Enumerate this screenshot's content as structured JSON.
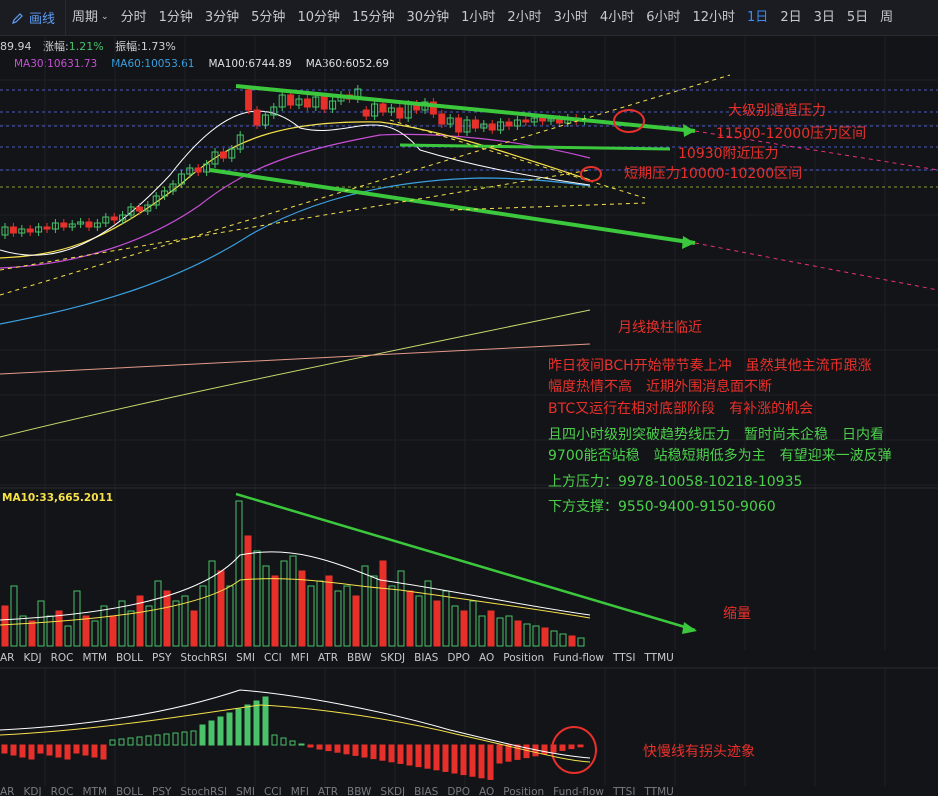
{
  "toolbar": {
    "draw_label": "画线",
    "period_label": "周期",
    "periods": [
      "分时",
      "1分钟",
      "3分钟",
      "5分钟",
      "10分钟",
      "15分钟",
      "30分钟",
      "1小时",
      "2小时",
      "3小时",
      "4小时",
      "6小时",
      "12小时",
      "1日",
      "2日",
      "3日",
      "5日",
      "周"
    ],
    "active_period": "1日"
  },
  "info": {
    "price_fragment": "89.94",
    "change_label": "涨幅:",
    "change_value": "1.21%",
    "amplitude_label": "振幅:",
    "amplitude_value": "1.73%"
  },
  "ma_legend": [
    {
      "text": "MA30:10631.73",
      "color": "#c74fd6"
    },
    {
      "text": "MA60:10053.61",
      "color": "#3aa0e0"
    },
    {
      "text": "MA100:6744.89",
      "color": "#e0e0e0"
    },
    {
      "text": "MA360:6052.69",
      "color": "#e0e0e0"
    }
  ],
  "volume_label": "MA10:33,665.2011",
  "indicator_tabs": [
    "AR",
    "KDJ",
    "ROC",
    "MTM",
    "BOLL",
    "PSY",
    "StochRSI",
    "SMI",
    "CCI",
    "MFI",
    "ATR",
    "BBW",
    "SKDJ",
    "BIAS",
    "DPO",
    "AO",
    "Position",
    "Fund-flow",
    "TTSI",
    "TTMU"
  ],
  "indicator_tabs_bottom": [
    "AR",
    "KDJ",
    "ROC",
    "MTM",
    "BOLL",
    "PSY",
    "StochRSI",
    "SMI",
    "CCI",
    "MFI",
    "ATR",
    "BBW",
    "SKDJ",
    "BIAS",
    "DPO",
    "AO",
    "Position",
    "Fund-flow",
    "TTSI",
    "TTMU"
  ],
  "annotations": {
    "channel_pressure": "大级别通道压力",
    "range_11500": "11500-12000压力区间",
    "near_10930": "10930附近压力",
    "short_term": "短期压力10000-10200区间",
    "monthly": "月线换柱临近",
    "para1_line1": "昨日夜间BCH开始带节奏上冲　虽然其他主流币跟涨",
    "para1_line2": "幅度热情不高　近期外围消息面不断",
    "para1_line3": "BTC又运行在相对底部阶段　有补涨的机会",
    "para2_line1": "且四小时级别突破趋势线压力　暂时尚未企稳　日内看",
    "para2_line2": "9700能否站稳　站稳短期低多为主　有望迎来一波反弹",
    "upper_pressure": "上方压力：9978-10058-10218-10935",
    "lower_support": "下方支撑：9550-9400-9150-9060",
    "shrink": "缩量",
    "macd_note": "快慢线有拐头迹象"
  },
  "colors": {
    "up": "#e8302b",
    "down": "#49c26a",
    "accent": "#3d8bf5"
  }
}
